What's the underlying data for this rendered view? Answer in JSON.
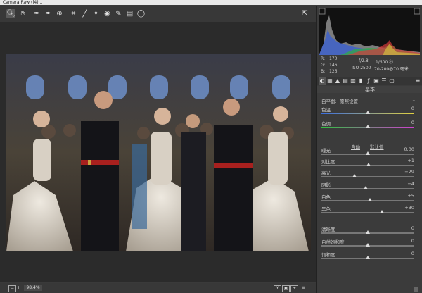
{
  "window": {
    "title_fragment": "Camera Raw (f4)…"
  },
  "toolbar": {
    "tools": [
      "zoom-icon",
      "hand-icon",
      "white-balance-icon",
      "color-sampler-icon",
      "target-adjust-icon",
      "crop-icon",
      "straighten-icon",
      "spot-removal-icon",
      "red-eye-icon",
      "adjustment-brush-icon",
      "graduated-filter-icon",
      "radial-filter-icon"
    ],
    "fullscreen_icon": "fullscreen-icon"
  },
  "status": {
    "zoom": "98.4%"
  },
  "readout": {
    "r_label": "R:",
    "r_val": "170",
    "g_label": "G:",
    "g_val": "146",
    "b_label": "B:",
    "b_val": "126",
    "aperture": "f/2.8",
    "shutter": "1/500 秒",
    "iso": "ISO 2500",
    "lens": "70-200@70 毫米"
  },
  "panel": {
    "title": "基本",
    "wb_label": "白平衡:",
    "wb_value": "原照设置",
    "auto": "自动",
    "default": "默认值",
    "sliders": [
      {
        "label": "色温",
        "value": "0",
        "pos": 0.5,
        "colors": [
          "#3a6ee0",
          "#e0d040"
        ]
      },
      {
        "label": "色调",
        "value": "0",
        "pos": 0.5,
        "colors": [
          "#30c040",
          "#d040d0"
        ]
      },
      {
        "label": "曝光",
        "value": "0.00",
        "pos": 0.5
      },
      {
        "label": "对比度",
        "value": "+1",
        "pos": 0.505
      },
      {
        "label": "高光",
        "value": "−29",
        "pos": 0.355
      },
      {
        "label": "阴影",
        "value": "−4",
        "pos": 0.48
      },
      {
        "label": "白色",
        "value": "+5",
        "pos": 0.525
      },
      {
        "label": "黑色",
        "value": "+30",
        "pos": 0.65
      },
      {
        "label": "清晰度",
        "value": "0",
        "pos": 0.5
      },
      {
        "label": "自然饱和度",
        "value": "0",
        "pos": 0.5
      },
      {
        "label": "饱和度",
        "value": "0",
        "pos": 0.5
      }
    ]
  }
}
